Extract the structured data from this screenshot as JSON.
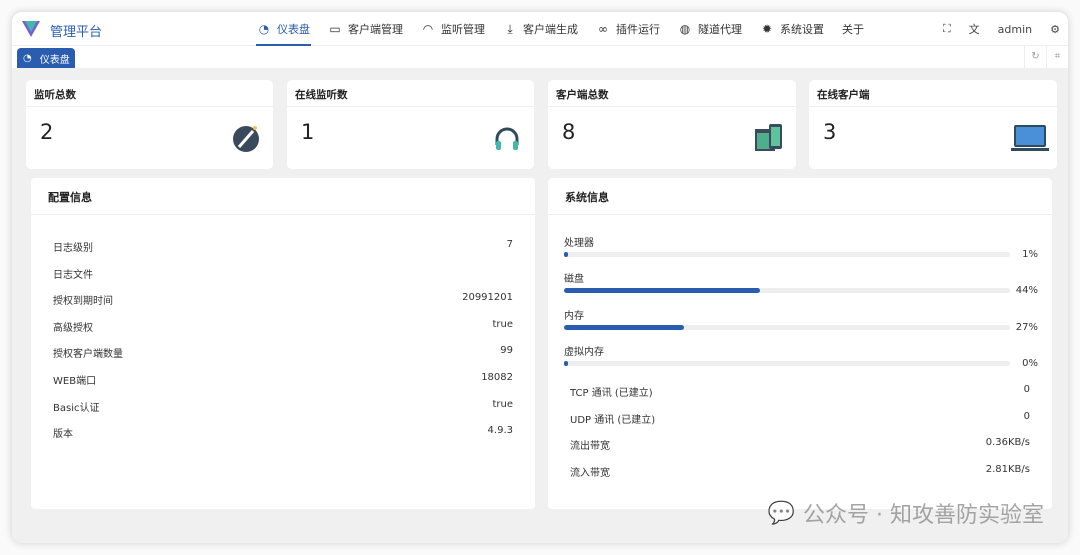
{
  "app": {
    "title": "管理平台"
  },
  "nav": [
    {
      "label": "仪表盘",
      "icon": "dashboard-icon",
      "active": true
    },
    {
      "label": "客户端管理",
      "icon": "monitor-icon"
    },
    {
      "label": "监听管理",
      "icon": "headphones-icon"
    },
    {
      "label": "客户端生成",
      "icon": "download-icon"
    },
    {
      "label": "插件运行",
      "icon": "link-icon"
    },
    {
      "label": "隧道代理",
      "icon": "globe-icon"
    },
    {
      "label": "系统设置",
      "icon": "gear-icon"
    },
    {
      "label": "关于"
    }
  ],
  "header_right": {
    "user": "admin"
  },
  "tabs": [
    {
      "label": "仪表盘"
    }
  ],
  "stats": [
    {
      "title": "监听总数",
      "value": "2"
    },
    {
      "title": "在线监听数",
      "value": "1"
    },
    {
      "title": "客户端总数",
      "value": "8"
    },
    {
      "title": "在线客户端",
      "value": "3"
    }
  ],
  "config": {
    "title": "配置信息",
    "rows": [
      {
        "k": "日志级别",
        "v": "7"
      },
      {
        "k": "日志文件",
        "v": ""
      },
      {
        "k": "授权到期时间",
        "v": "20991201"
      },
      {
        "k": "高级授权",
        "v": "true"
      },
      {
        "k": "授权客户端数量",
        "v": "99"
      },
      {
        "k": "WEB端口",
        "v": "18082"
      },
      {
        "k": "Basic认证",
        "v": "true"
      },
      {
        "k": "版本",
        "v": "4.9.3"
      }
    ]
  },
  "system": {
    "title": "系统信息",
    "bars": [
      {
        "label": "处理器",
        "pct": 1,
        "text": "1%"
      },
      {
        "label": "磁盘",
        "pct": 44,
        "text": "44%"
      },
      {
        "label": "内存",
        "pct": 27,
        "text": "27%"
      },
      {
        "label": "虚拟内存",
        "pct": 0,
        "text": "0%"
      }
    ],
    "rows": [
      {
        "k": "TCP 通讯 (已建立)",
        "v": "0"
      },
      {
        "k": "UDP 通讯 (已建立)",
        "v": "0"
      },
      {
        "k": "流出带宽",
        "v": "0.36KB/s"
      },
      {
        "k": "流入带宽",
        "v": "2.81KB/s"
      }
    ]
  },
  "watermark": "公众号 · 知攻善防实验室",
  "colors": {
    "accent": "#2a5db0"
  }
}
